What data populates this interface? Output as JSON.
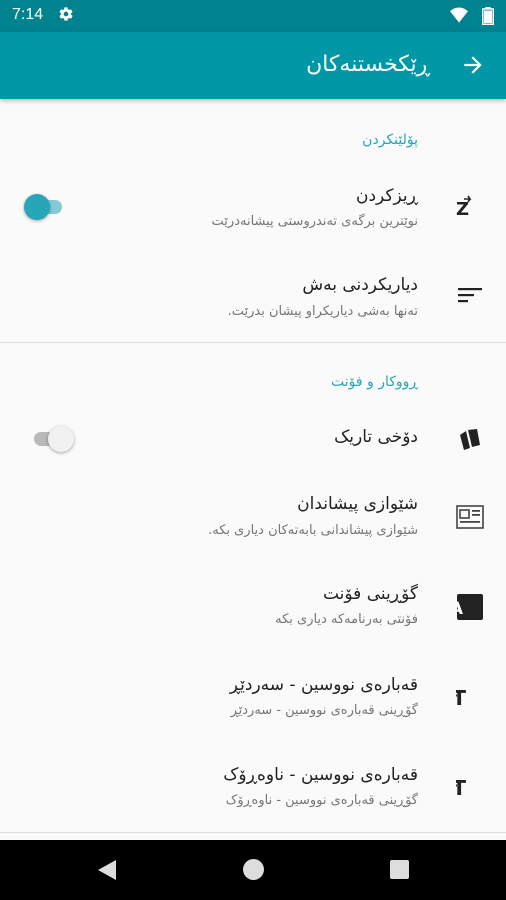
{
  "status_bar": {
    "time": "7:14"
  },
  "app_bar": {
    "title": "ڕێکخستنەکان"
  },
  "sections": {
    "sorting": {
      "header": "پۆلێنکردن",
      "sort_title": "ڕیزکردن",
      "sort_summary": "نوێترین برگەی تەندروستی پیشانەدرێت",
      "sort_toggle_on": true,
      "section_filter_title": "دیاریکردنی بەش",
      "section_filter_summary": "تەنها بەشی دیاریکراو پیشان بدرێت."
    },
    "appearance": {
      "header": "ڕووکار و فۆنت",
      "dark_mode_title": "دۆخی تاریک",
      "dark_mode_on": false,
      "preview_style_title": "شێوازی پیشاندان",
      "preview_style_summary": "شێوازی پیشاندانی بابەتەکان دیاری بکە.",
      "change_font_title": "گۆڕینی فۆنت",
      "change_font_summary": "فۆنتی بەرنامەکە دیاری بکە",
      "title_size_title": "قەبارەی نووسین - سەردێڕ",
      "title_size_summary": "گۆڕینی قەبارەی نووسین - سەردێڕ",
      "content_size_title": "قەبارەی نووسین - ناوەڕۆک",
      "content_size_summary": "گۆڕینی قەبارەی نووسین - ناوەڕۆک"
    }
  },
  "icons": {
    "back": "arrow-forward-icon",
    "sort": "sort-az-icon",
    "filter": "filter-lines-icon",
    "dark": "cards-icon",
    "preview": "article-icon",
    "font": "font-a-icon",
    "size": "text-size-icon"
  },
  "colors": {
    "primary": "#0097a7",
    "primary_dark": "#00838f",
    "accent": "#26a6b6"
  }
}
